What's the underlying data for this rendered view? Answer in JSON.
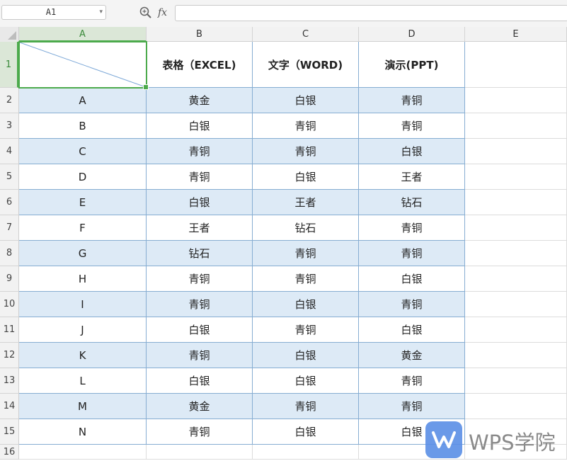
{
  "formula_bar": {
    "cell_ref": "A1",
    "fx_label": "fx",
    "formula_value": ""
  },
  "columns": [
    "A",
    "B",
    "C",
    "D",
    "E"
  ],
  "rows": [
    "1",
    "2",
    "3",
    "4",
    "5",
    "6",
    "7",
    "8",
    "9",
    "10",
    "11",
    "12",
    "13",
    "14",
    "15",
    "16"
  ],
  "selected_cell": "A1",
  "table": {
    "headers": [
      "",
      "表格（EXCEL)",
      "文字（WORD)",
      "演示(PPT)"
    ],
    "rows": [
      [
        "A",
        "黄金",
        "白银",
        "青铜"
      ],
      [
        "B",
        "白银",
        "青铜",
        "青铜"
      ],
      [
        "C",
        "青铜",
        "青铜",
        "白银"
      ],
      [
        "D",
        "青铜",
        "白银",
        "王者"
      ],
      [
        "E",
        "白银",
        "王者",
        "钻石"
      ],
      [
        "F",
        "王者",
        "钻石",
        "青铜"
      ],
      [
        "G",
        "钻石",
        "青铜",
        "青铜"
      ],
      [
        "H",
        "青铜",
        "青铜",
        "白银"
      ],
      [
        "I",
        "青铜",
        "白银",
        "青铜"
      ],
      [
        "J",
        "白银",
        "青铜",
        "白银"
      ],
      [
        "K",
        "青铜",
        "白银",
        "黄金"
      ],
      [
        "L",
        "白银",
        "白银",
        "青铜"
      ],
      [
        "M",
        "黄金",
        "青铜",
        "青铜"
      ],
      [
        "N",
        "青铜",
        "白银",
        "白银"
      ]
    ]
  },
  "colors": {
    "band": "#ddeaf6",
    "table_border": "#86add2",
    "selection": "#4caa4c",
    "diagonal": "#7ea9d8"
  },
  "watermark": {
    "text": "WPS学院",
    "icon": "wps-logo-icon"
  }
}
